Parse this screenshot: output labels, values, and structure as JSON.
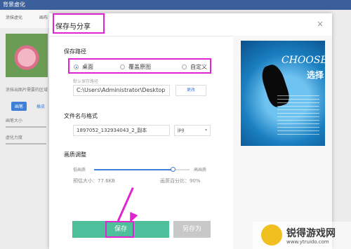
{
  "app": {
    "title": "背景虚化",
    "tabs": [
      "涂抹虚化",
      "画布"
    ],
    "photo_caption": "涂抹出图片需要的区域",
    "buttons": [
      "画笔",
      "橡皮"
    ],
    "slider_labels": [
      "画笔大小",
      "虚化力度"
    ]
  },
  "dialog": {
    "title": "保存与分享",
    "close": "×",
    "save_path": {
      "label": "保存路径",
      "options": [
        {
          "label": "桌面",
          "selected": true
        },
        {
          "label": "覆盖原图",
          "selected": false
        },
        {
          "label": "自定义",
          "selected": false
        }
      ],
      "default_label": "默认保存路径",
      "path_value": "C:\\Users\\Administrator\\Desktop",
      "change_label": "更改"
    },
    "file": {
      "label": "文件名与格式",
      "name_value": "1897052_132934043_2_副本",
      "format_value": "jpg"
    },
    "quality": {
      "label": "画质调整",
      "low_label": "低画质",
      "high_label": "高画质",
      "level": 0.82,
      "size_text": "预估大小：77.6KB",
      "percent_text": "画质百分比：90%"
    },
    "buttons": {
      "save": "保存",
      "save_as": "另存为"
    },
    "preview": {
      "big_text": "CHOOSE",
      "cn_text": "选择"
    }
  },
  "watermark": {
    "name": "锐得游戏网",
    "url": "www.ytruido.com"
  },
  "colors": {
    "highlight": "#e024d0",
    "accent": "#3f7fd6",
    "save_green": "#4dbf9a"
  }
}
